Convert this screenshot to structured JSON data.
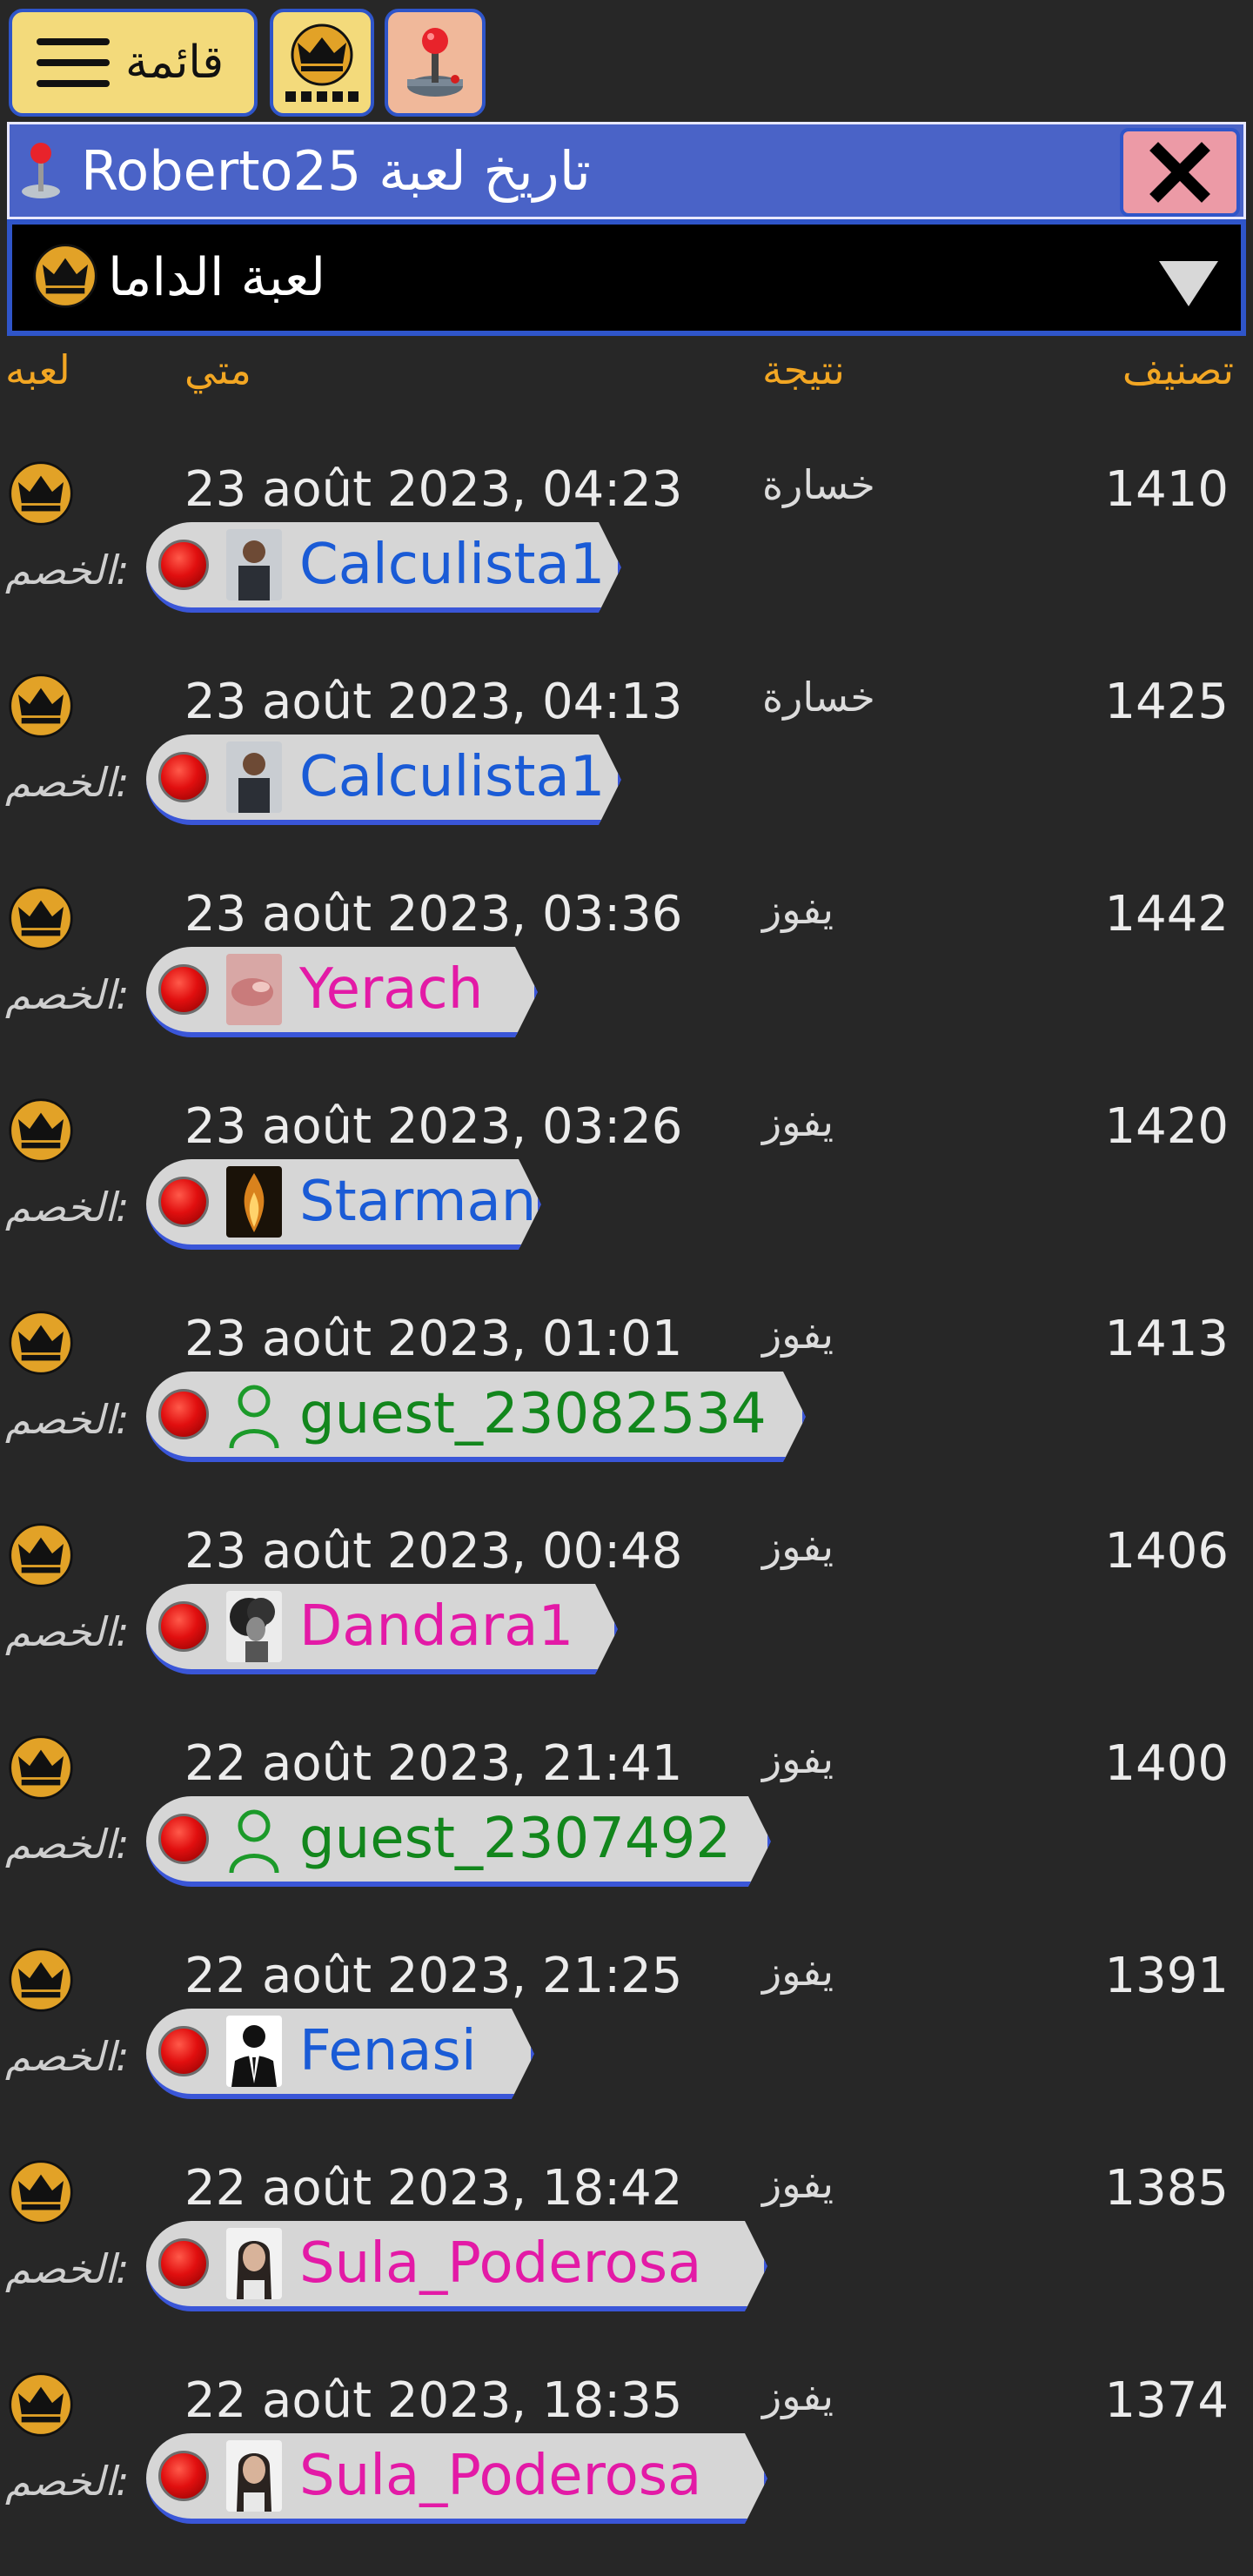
{
  "toolbar": {
    "menu_label": "قائمة",
    "icons": [
      "hamburger-icon",
      "crown-icon",
      "joystick-icon"
    ]
  },
  "titlebar": {
    "title": "Roberto25 تاريخ لعبة",
    "close_icon": "close-icon",
    "background": "#4a63c7"
  },
  "selector": {
    "label": "لعبة الداما",
    "icon": "crown-icon"
  },
  "columns": {
    "game": "لعبه",
    "when": "متي",
    "result": "نتيجة",
    "rating": "تصنيف"
  },
  "opponent_label": "الخصم:",
  "rows": [
    {
      "date": "23 août 2023, 04:23",
      "result": "خسارة",
      "rating": "1410",
      "opponent": "Calculista1",
      "name_color": "blue",
      "avatar": "photo-man"
    },
    {
      "date": "23 août 2023, 04:13",
      "result": "خسارة",
      "rating": "1425",
      "opponent": "Calculista1",
      "name_color": "blue",
      "avatar": "photo-man"
    },
    {
      "date": "23 août 2023, 03:36",
      "result": "يفوز",
      "rating": "1442",
      "opponent": "Yerach",
      "name_color": "pink",
      "avatar": "photo-pink"
    },
    {
      "date": "23 août 2023, 03:26",
      "result": "يفوز",
      "rating": "1420",
      "opponent": "Starman",
      "name_color": "blue",
      "avatar": "photo-fire"
    },
    {
      "date": "23 août 2023, 01:01",
      "result": "يفوز",
      "rating": "1413",
      "opponent": "guest_23082534",
      "name_color": "green",
      "avatar": "guest-user-icon"
    },
    {
      "date": "23 août 2023, 00:48",
      "result": "يفوز",
      "rating": "1406",
      "opponent": "Dandara1",
      "name_color": "pink",
      "avatar": "photo-curly"
    },
    {
      "date": "22 août 2023, 21:41",
      "result": "يفوز",
      "rating": "1400",
      "opponent": "guest_2307492",
      "name_color": "green",
      "avatar": "guest-user-icon"
    },
    {
      "date": "22 août 2023, 21:25",
      "result": "يفوز",
      "rating": "1391",
      "opponent": "Fenasi",
      "name_color": "blue",
      "avatar": "businessman-icon"
    },
    {
      "date": "22 août 2023, 18:42",
      "result": "يفوز",
      "rating": "1385",
      "opponent": "Sula_Poderosa",
      "name_color": "pink",
      "avatar": "photo-woman"
    },
    {
      "date": "22 août 2023, 18:35",
      "result": "يفوز",
      "rating": "1374",
      "opponent": "Sula_Poderosa",
      "name_color": "pink",
      "avatar": "photo-woman"
    }
  ],
  "colors": {
    "background": "#272727",
    "header_text": "#f2a623",
    "accent_border": "#2f55c9",
    "button_yellow": "#f3da7b",
    "close_button": "#ec9aa6"
  }
}
